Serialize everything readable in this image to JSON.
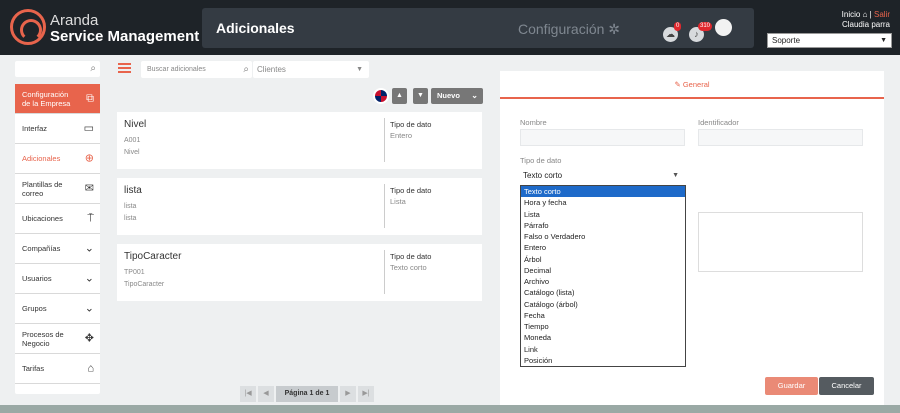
{
  "header": {
    "brand_line1": "Aranda",
    "brand_line2": "Service Management",
    "page_title": "Adicionales",
    "config_label": "Configuración",
    "notif_count_1": "0",
    "notif_count_2": "310",
    "inicio": "Inicio",
    "separator": "|",
    "salir": "Salir",
    "user_name": "Claudia parra",
    "role_select": "Soporte"
  },
  "sidebar": {
    "items": [
      {
        "label": "Configuración de la Empresa",
        "icon": "layers-icon"
      },
      {
        "label": "Interfaz",
        "icon": "monitor-icon"
      },
      {
        "label": "Adicionales",
        "icon": "add-circle-icon"
      },
      {
        "label": "Plantillas de correo",
        "icon": "mail-icon"
      },
      {
        "label": "Ubicaciones",
        "icon": "signpost-icon"
      },
      {
        "label": "Compañías",
        "icon": "chevron-down-icon"
      },
      {
        "label": "Usuarios",
        "icon": "chevron-down-icon"
      },
      {
        "label": "Grupos",
        "icon": "chevron-down-icon"
      },
      {
        "label": "Procesos de Negocio",
        "icon": "move-icon"
      },
      {
        "label": "Tarifas",
        "icon": "bank-icon"
      }
    ]
  },
  "toolbar": {
    "search_placeholder": "Buscar adicionales",
    "client_select": "Clientes",
    "new_button": "Nuevo"
  },
  "list": {
    "items": [
      {
        "name": "Nivel",
        "id": "A001",
        "desc": "Nivel",
        "type_label": "Tipo de dato",
        "type_value": "Entero"
      },
      {
        "name": "lista",
        "id": "lista",
        "desc": "lista",
        "type_label": "Tipo de dato",
        "type_value": "Lista"
      },
      {
        "name": "TipoCaracter",
        "id": "TP001",
        "desc": "TipoCaracter",
        "type_label": "Tipo de dato",
        "type_value": "Texto corto"
      }
    ]
  },
  "pagination": {
    "label": "Página 1 de 1"
  },
  "form": {
    "tab_general": "General",
    "name_label": "Nombre",
    "identifier_label": "Identificador",
    "type_label": "Tipo de dato",
    "type_selected": "Texto corto",
    "options": [
      "Texto corto",
      "Hora y fecha",
      "Lista",
      "Párrafo",
      "Falso o Verdadero",
      "Entero",
      "Árbol",
      "Decimal",
      "Archivo",
      "Catálogo (lista)",
      "Catálogo (árbol)",
      "Fecha",
      "Tiempo",
      "Moneda",
      "Link",
      "Posición"
    ],
    "save_button": "Guardar",
    "cancel_button": "Cancelar"
  },
  "colors": {
    "accent": "#e8644c",
    "topbar": "#1e2328",
    "selected_option": "#1e6ac9"
  }
}
